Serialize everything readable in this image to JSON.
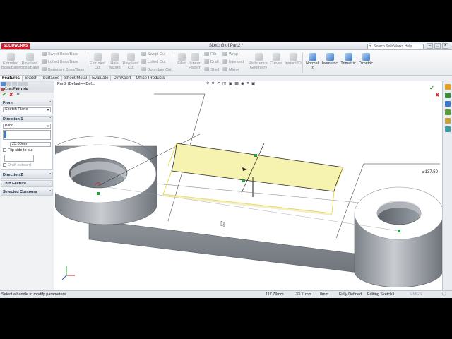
{
  "window": {
    "app_logo": "SOLIDWORKS",
    "title": "Sketch3 of Part2 *",
    "help_search_placeholder": "Search SolidWorks Help"
  },
  "command_manager": {
    "extruded_boss": "Extruded Boss/Base",
    "revolved_boss": "Revolved Boss/Base",
    "swept_boss": "Swept Boss/Base",
    "lofted_boss": "Lofted Boss/Base",
    "boundary_boss": "Boundary Boss/Base",
    "extruded_cut": "Extruded Cut",
    "hole_wizard": "Hole Wizard",
    "revolved_cut": "Revolved Cut",
    "swept_cut": "Swept Cut",
    "lofted_cut": "Lofted Cut",
    "boundary_cut": "Boundary Cut",
    "fillet": "Fillet",
    "linear_pattern": "Linear Pattern",
    "rib": "Rib",
    "draft": "Draft",
    "shell": "Shell",
    "wrap": "Wrap",
    "intersect": "Intersect",
    "mirror": "Mirror",
    "reference_geometry": "Reference Geometry",
    "curves": "Curves",
    "instant3d": "Instant3D",
    "normal_to": "Normal To",
    "isometric": "Isometric",
    "trimetric": "Trimetric",
    "dimetric": "Dimetric"
  },
  "tabs": [
    "Features",
    "Sketch",
    "Surfaces",
    "Sheet Metal",
    "Evaluate",
    "DimXpert",
    "Office Products"
  ],
  "property_manager": {
    "title": "Cut-Extrude",
    "from": {
      "header": "From",
      "value": "Sketch Plane"
    },
    "direction1": {
      "header": "Direction 1",
      "end_condition": "Blind",
      "depth": "25.00mm",
      "flip_side": "Flip side to cut",
      "draft_outward": "Draft outward"
    },
    "direction2": "Direction 2",
    "thin_feature": "Thin Feature",
    "selected_contours": "Selected Contours"
  },
  "viewport": {
    "tree_flyout": "Part2  (Default<<Def...",
    "dimension_label": "⌀137.50"
  },
  "status_bar": {
    "hint": "Select a handle to modify parameters",
    "x": "117.79mm",
    "y": "-33.11mm",
    "z": "0mm",
    "state": "Fully Defined",
    "editing": "Editing Sketch3",
    "units": "MMGS"
  }
}
